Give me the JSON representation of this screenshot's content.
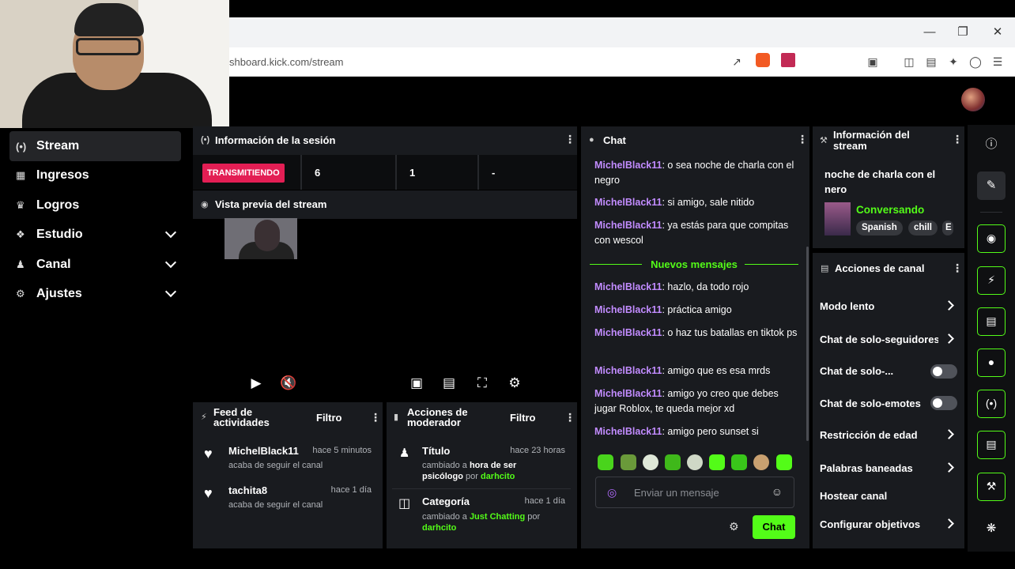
{
  "browser": {
    "url": "shboard.kick.com/stream",
    "window_controls": [
      "minimize-icon",
      "restore-icon",
      "close-icon"
    ]
  },
  "nav": {
    "items": [
      {
        "label": "Stream",
        "icon": "broadcast-icon",
        "active": true
      },
      {
        "label": "Ingresos",
        "icon": "chart-icon"
      },
      {
        "label": "Logros",
        "icon": "trophy-icon"
      },
      {
        "label": "Estudio",
        "icon": "palette-icon",
        "expandable": true
      },
      {
        "label": "Canal",
        "icon": "users-icon",
        "expandable": true
      },
      {
        "label": "Ajustes",
        "icon": "gear-icon",
        "expandable": true
      }
    ]
  },
  "session": {
    "title": "Información de la sesión",
    "live_badge": "TRANSMITIENDO",
    "stats": [
      "6",
      "1",
      "-"
    ]
  },
  "preview": {
    "title": "Vista previa del stream"
  },
  "activity_feed": {
    "title": "Feed de actividades",
    "filter_label": "Filtro",
    "items": [
      {
        "name": "MichelBlack11",
        "time": "hace 5 minutos",
        "sub": "acaba de seguir el canal"
      },
      {
        "name": "tachita8",
        "time": "hace 1 día",
        "sub": "acaba de seguir el canal"
      }
    ]
  },
  "mod_actions": {
    "title": "Acciones de moderador",
    "filter_label": "Filtro",
    "items": [
      {
        "title": "Título",
        "time": "hace 23 horas",
        "pre": "cambiado a ",
        "value": "hora de ser psicólogo",
        "by": " por ",
        "user": "darhcito"
      },
      {
        "title": "Categoría",
        "time": "hace 1 día",
        "pre": "cambiado a ",
        "value": "Just Chatting",
        "by": " por ",
        "user": "darhcito"
      }
    ]
  },
  "chat": {
    "title": "Chat",
    "messages_before": [
      {
        "user": "MichelBlack11",
        "text": ": o sea noche de charla con el negro"
      },
      {
        "user": "MichelBlack11",
        "text": ": si amigo, sale nitido"
      },
      {
        "user": "MichelBlack11",
        "text": ": ya estás para que compitas con wescol"
      }
    ],
    "new_messages_label": "Nuevos mensajes",
    "messages_after": [
      {
        "user": "MichelBlack11",
        "text": ": hazlo, da todo rojo"
      },
      {
        "user": "MichelBlack11",
        "text": ": práctica amigo"
      },
      {
        "user": "MichelBlack11",
        "text": ": o haz tus batallas en tiktok ps"
      },
      {
        "user": "MichelBlack11",
        "text": ": amigo que es esa mrds"
      },
      {
        "user": "MichelBlack11",
        "text": ": amigo yo creo que debes jugar Roblox, te queda mejor xd"
      },
      {
        "user": "MichelBlack11",
        "text": ": amigo pero sunset si"
      }
    ],
    "input_placeholder": "Enviar un mensaje",
    "send_label": "Chat"
  },
  "stream_info": {
    "title_line1": "Información del",
    "title_line2": "stream",
    "stream_title": "noche de charla con el nero",
    "category": "Conversando",
    "tags": [
      "Spanish",
      "chill",
      "E"
    ]
  },
  "channel_actions": {
    "title": "Acciones de canal",
    "items": [
      {
        "label": "Modo lento",
        "control": "chevron"
      },
      {
        "label": "Chat de solo-seguidores",
        "control": "chevron"
      },
      {
        "label": "Chat de solo-...",
        "control": "toggle"
      },
      {
        "label": "Chat de solo-emotes",
        "control": "toggle"
      },
      {
        "label": "Restricción de edad",
        "control": "chevron"
      },
      {
        "label": "Palabras baneadas",
        "control": "chevron"
      },
      {
        "label": "Hostear canal",
        "control": "none"
      },
      {
        "label": "Configurar objetivos",
        "control": "chevron"
      }
    ]
  },
  "right_rail": {
    "icons": [
      "info-icon",
      "pencil-icon",
      "camera-icon",
      "lightning-icon",
      "notes-icon",
      "chat-bubble-icon",
      "broadcast-icon",
      "layout-icon",
      "wrench-icon",
      "nodes-icon"
    ]
  },
  "colors": {
    "accent": "#53fc18",
    "live": "#e31e54",
    "username": "#c28cff",
    "panel": "#191b1f"
  }
}
